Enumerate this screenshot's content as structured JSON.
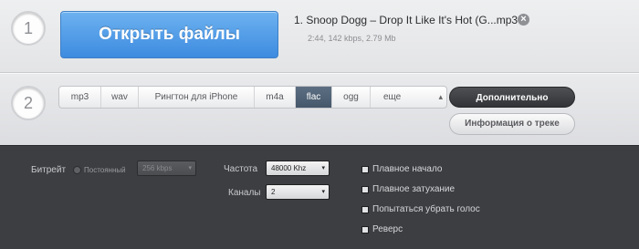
{
  "step1": {
    "number": "1",
    "open_button": "Открыть файлы",
    "file": {
      "title": "1. Snoop Dogg – Drop It Like It's Hot (G...mp3",
      "meta": "2:44, 142 kbps, 2.79 Mb",
      "remove_icon": "×"
    }
  },
  "step2": {
    "number": "2",
    "formats": [
      {
        "label": "mp3",
        "active": false
      },
      {
        "label": "wav",
        "active": false
      },
      {
        "label": "Рингтон для iPhone",
        "active": false
      },
      {
        "label": "m4a",
        "active": false
      },
      {
        "label": "flac",
        "active": true
      },
      {
        "label": "ogg",
        "active": false
      },
      {
        "label": "еще",
        "active": false
      }
    ],
    "more_arrows_icon": "updown-arrows-icon",
    "advanced_button": "Дополнительно",
    "track_info_button": "Информация о треке"
  },
  "advanced": {
    "bitrate": {
      "label": "Битрейт",
      "radio_label": "Постоянный",
      "value": "256 kbps"
    },
    "frequency": {
      "label": "Частота",
      "value": "48000 Khz"
    },
    "channels": {
      "label": "Каналы",
      "value": "2"
    },
    "options": [
      {
        "label": "Плавное начало",
        "checked": false
      },
      {
        "label": "Плавное затухание",
        "checked": false
      },
      {
        "label": "Попытаться убрать голос",
        "checked": false
      },
      {
        "label": "Реверс",
        "checked": false
      }
    ]
  },
  "colors": {
    "open_button": "#4a97e6",
    "active_format": "#4f6175",
    "panel": "#3c3e41"
  }
}
